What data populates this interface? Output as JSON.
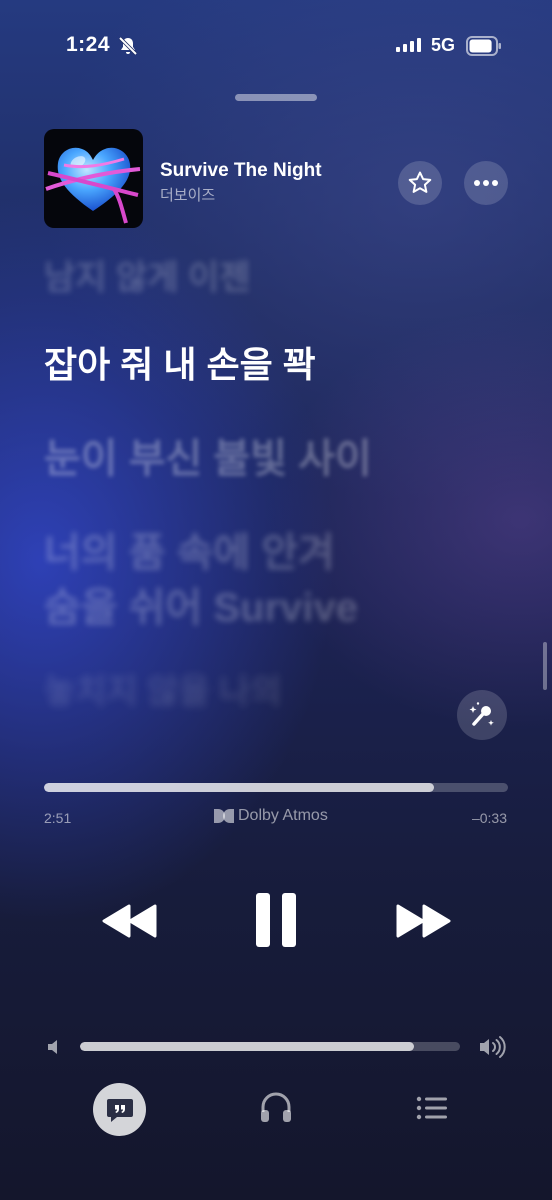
{
  "status_bar": {
    "time": "1:24",
    "network": "5G",
    "icons": [
      "bell-slash-icon",
      "cellular-signal-icon",
      "battery-icon"
    ],
    "battery_level": 0.85
  },
  "now_playing": {
    "title": "Survive The Night",
    "artist": "더보이즈",
    "artwork_icon": "heart-artwork"
  },
  "lyrics": {
    "previous": "남지 않게 이젠",
    "current": "잡아 줘 내 손을 꽉",
    "upcoming": [
      "눈이 부신 불빛 사이",
      "너의 품 속에 안겨",
      "숨을 쉬어 Survive",
      "놓치지 않을 나의"
    ]
  },
  "playback": {
    "elapsed": "2:51",
    "remaining": "–0:33",
    "progress": 0.84,
    "audio_format": "Dolby Atmos",
    "volume": 0.88
  },
  "icons": {
    "favorite": "star-icon",
    "more": "ellipsis-icon",
    "sing": "microphone-sparkles-icon",
    "rewind": "rewind-icon",
    "pause": "pause-icon",
    "forward": "fast-forward-icon",
    "lyrics": "quote-bubble-icon",
    "airplay": "headphones-icon",
    "queue": "list-icon"
  }
}
